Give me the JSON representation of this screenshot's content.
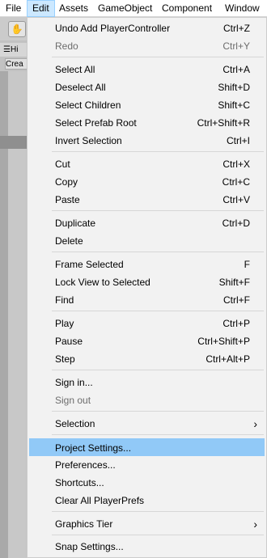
{
  "menubar": {
    "items": [
      "File",
      "Edit",
      "Assets",
      "GameObject",
      "Component",
      "Window"
    ],
    "active": "Edit"
  },
  "background": {
    "hierarchy_tab": "Hi",
    "create_button": "Crea"
  },
  "edit_menu": {
    "items": [
      {
        "label": "Undo Add PlayerController",
        "shortcut": "Ctrl+Z"
      },
      {
        "label": "Redo",
        "shortcut": "Ctrl+Y",
        "disabled": true
      },
      {
        "label": "Select All",
        "shortcut": "Ctrl+A"
      },
      {
        "label": "Deselect All",
        "shortcut": "Shift+D"
      },
      {
        "label": "Select Children",
        "shortcut": "Shift+C"
      },
      {
        "label": "Select Prefab Root",
        "shortcut": "Ctrl+Shift+R"
      },
      {
        "label": "Invert Selection",
        "shortcut": "Ctrl+I"
      },
      {
        "label": "Cut",
        "shortcut": "Ctrl+X"
      },
      {
        "label": "Copy",
        "shortcut": "Ctrl+C"
      },
      {
        "label": "Paste",
        "shortcut": "Ctrl+V"
      },
      {
        "label": "Duplicate",
        "shortcut": "Ctrl+D"
      },
      {
        "label": "Delete",
        "shortcut": ""
      },
      {
        "label": "Frame Selected",
        "shortcut": "F"
      },
      {
        "label": "Lock View to Selected",
        "shortcut": "Shift+F"
      },
      {
        "label": "Find",
        "shortcut": "Ctrl+F"
      },
      {
        "label": "Play",
        "shortcut": "Ctrl+P"
      },
      {
        "label": "Pause",
        "shortcut": "Ctrl+Shift+P"
      },
      {
        "label": "Step",
        "shortcut": "Ctrl+Alt+P"
      },
      {
        "label": "Sign in...",
        "shortcut": ""
      },
      {
        "label": "Sign out",
        "shortcut": "",
        "disabled": true
      },
      {
        "label": "Selection",
        "shortcut": "",
        "submenu": true
      },
      {
        "label": "Project Settings...",
        "shortcut": "",
        "highlighted": true
      },
      {
        "label": "Preferences...",
        "shortcut": ""
      },
      {
        "label": "Shortcuts...",
        "shortcut": ""
      },
      {
        "label": "Clear All PlayerPrefs",
        "shortcut": ""
      },
      {
        "label": "Graphics Tier",
        "shortcut": "",
        "submenu": true
      },
      {
        "label": "Snap Settings...",
        "shortcut": ""
      }
    ],
    "submenu_arrow": "›"
  },
  "colors": {
    "highlight": "#91c9f7",
    "menu_background": "#f2f2f2",
    "active_menubar": "#cce8ff"
  }
}
